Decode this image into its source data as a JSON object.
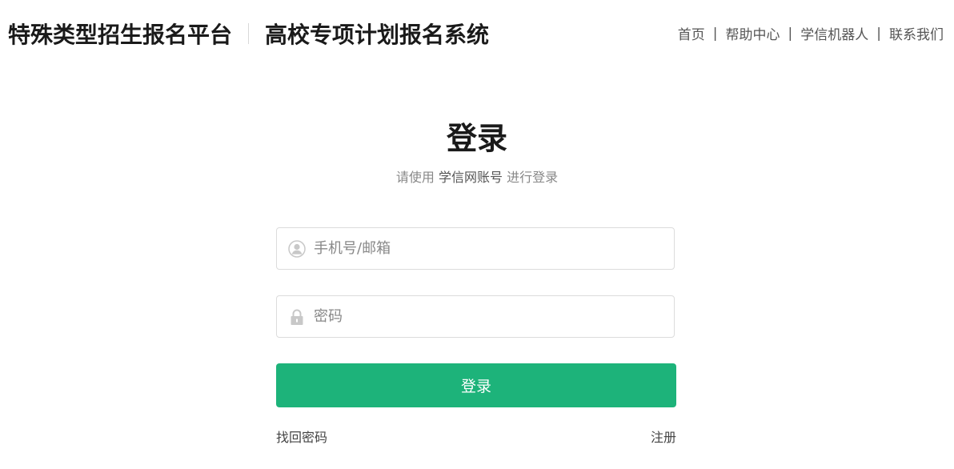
{
  "header": {
    "platform_name": "特殊类型招生报名平台",
    "system_name": "高校专项计划报名系统",
    "nav": {
      "home": "首页",
      "help": "帮助中心",
      "robot": "学信机器人",
      "contact": "联系我们",
      "separator": "|"
    }
  },
  "login": {
    "title": "登录",
    "subtitle_prefix": "请使用 ",
    "subtitle_account": "学信网账号",
    "subtitle_suffix": " 进行登录",
    "username_placeholder": "手机号/邮箱",
    "username_value": "",
    "password_placeholder": "密码",
    "password_value": "",
    "submit_label": "登录",
    "forgot_label": "找回密码",
    "register_label": "注册"
  },
  "icons": {
    "username": "user-icon",
    "password": "lock-icon"
  },
  "colors": {
    "accent": "#1db37a"
  }
}
